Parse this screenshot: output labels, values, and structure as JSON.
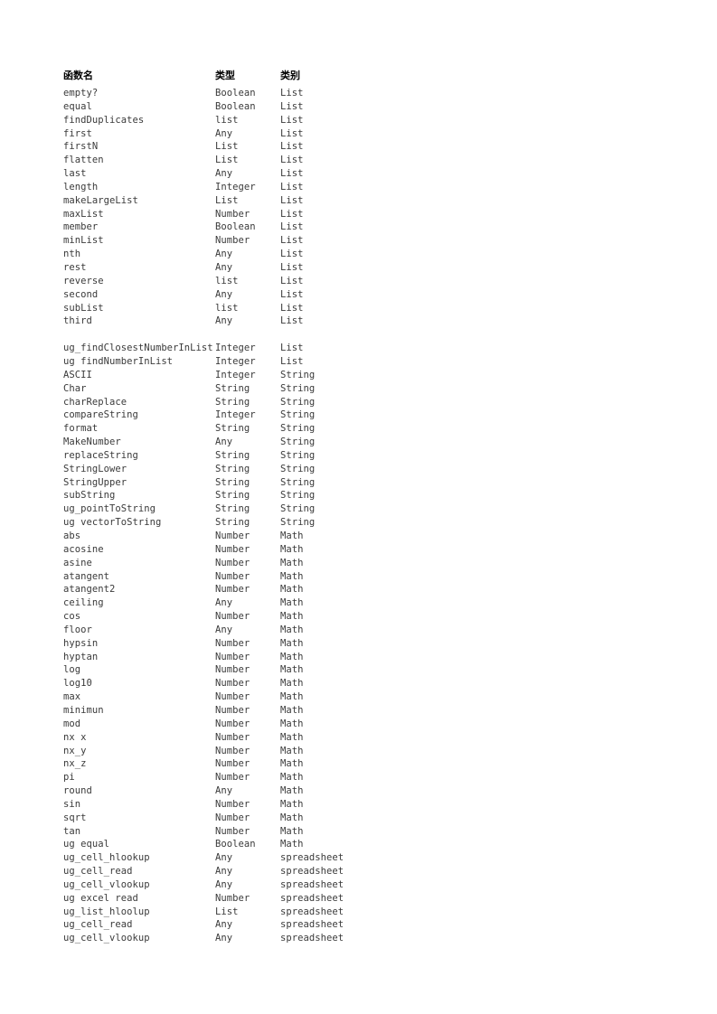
{
  "document": {
    "background_color": "#ffffff",
    "text_color": "#3a3a3a",
    "header_color": "#000000",
    "highlight_color": "#e0727c"
  },
  "table": {
    "columns": [
      {
        "key": "name",
        "label": "函数名"
      },
      {
        "key": "type",
        "label": "类型"
      },
      {
        "key": "category",
        "label": "类别"
      }
    ],
    "rows": [
      {
        "name": "empty?",
        "type": "Boolean",
        "category": "List",
        "highlight": false
      },
      {
        "name": "equal",
        "type": "Boolean",
        "category": "List",
        "highlight": false
      },
      {
        "name": "findDuplicates",
        "type": "list",
        "category": "List",
        "highlight": false
      },
      {
        "name": "first",
        "type": "Any",
        "category": "List",
        "highlight": false
      },
      {
        "name": "firstN",
        "type": "List",
        "category": "List",
        "highlight": false
      },
      {
        "name": "flatten",
        "type": "List",
        "category": "List",
        "highlight": false
      },
      {
        "name": "last",
        "type": "Any",
        "category": "List",
        "highlight": false
      },
      {
        "name": "length",
        "type": "Integer",
        "category": "List",
        "highlight": false
      },
      {
        "name": "makeLargeList",
        "type": "List",
        "category": "List",
        "highlight": false
      },
      {
        "name": "maxList",
        "type": "Number",
        "category": "List",
        "highlight": false
      },
      {
        "name": "member",
        "type": "Boolean",
        "category": "List",
        "highlight": false
      },
      {
        "name": "minList",
        "type": "Number",
        "category": "List",
        "highlight": false
      },
      {
        "name": "nth",
        "type": "Any",
        "category": "List",
        "highlight": true
      },
      {
        "name": "rest",
        "type": "Any",
        "category": "List",
        "highlight": false
      },
      {
        "name": "reverse",
        "type": "list",
        "category": "List",
        "highlight": false
      },
      {
        "name": "second",
        "type": "Any",
        "category": "List",
        "highlight": false
      },
      {
        "name": "subList",
        "type": "list",
        "category": "List",
        "highlight": false
      },
      {
        "name": "third",
        "type": "Any",
        "category": "List",
        "highlight": false
      },
      {
        "name": "",
        "type": "",
        "category": "",
        "highlight": false,
        "spacer": true
      },
      {
        "name": "ug_findClosestNumberInList",
        "type": "Integer",
        "category": "List",
        "highlight": false
      },
      {
        "name": "ug findNumberInList",
        "type": "Integer",
        "category": "List",
        "highlight": true
      },
      {
        "name": "ASCII",
        "type": "Integer",
        "category": "String",
        "highlight": false
      },
      {
        "name": "Char",
        "type": "String",
        "category": "String",
        "highlight": false
      },
      {
        "name": "charReplace",
        "type": "String",
        "category": "String",
        "highlight": false
      },
      {
        "name": "compareString",
        "type": "Integer",
        "category": "String",
        "highlight": false
      },
      {
        "name": "format",
        "type": "String",
        "category": "String",
        "highlight": false
      },
      {
        "name": "MakeNumber",
        "type": "Any",
        "category": "String",
        "highlight": false
      },
      {
        "name": "replaceString",
        "type": "String",
        "category": "String",
        "highlight": false
      },
      {
        "name": "StringLower",
        "type": "String",
        "category": "String",
        "highlight": false
      },
      {
        "name": "StringUpper",
        "type": "String",
        "category": "String",
        "highlight": false
      },
      {
        "name": "subString",
        "type": "String",
        "category": "String",
        "highlight": false
      },
      {
        "name": "ug_pointToString",
        "type": "String",
        "category": "String",
        "highlight": false
      },
      {
        "name": "ug vectorToString",
        "type": "String",
        "category": "String",
        "highlight": false
      },
      {
        "name": "abs",
        "type": "Number",
        "category": "Math",
        "highlight": false
      },
      {
        "name": "acosine",
        "type": "Number",
        "category": "Math",
        "highlight": false
      },
      {
        "name": "asine",
        "type": "Number",
        "category": "Math",
        "highlight": false
      },
      {
        "name": "atangent",
        "type": "Number",
        "category": "Math",
        "highlight": false
      },
      {
        "name": "atangent2",
        "type": "Number",
        "category": "Math",
        "highlight": false
      },
      {
        "name": "ceiling",
        "type": "Any",
        "category": "Math",
        "highlight": false
      },
      {
        "name": "cos",
        "type": "Number",
        "category": "Math",
        "highlight": false
      },
      {
        "name": "floor",
        "type": "Any",
        "category": "Math",
        "highlight": false
      },
      {
        "name": "hypsin",
        "type": "Number",
        "category": "Math",
        "highlight": false
      },
      {
        "name": "hyptan",
        "type": "Number",
        "category": "Math",
        "highlight": false
      },
      {
        "name": "log",
        "type": "Number",
        "category": "Math",
        "highlight": false
      },
      {
        "name": "log10",
        "type": "Number",
        "category": "Math",
        "highlight": false
      },
      {
        "name": "max",
        "type": "Number",
        "category": "Math",
        "highlight": false
      },
      {
        "name": "minimun",
        "type": "Number",
        "category": "Math",
        "highlight": false
      },
      {
        "name": "mod",
        "type": "Number",
        "category": "Math",
        "highlight": false
      },
      {
        "name": "nx x",
        "type": "Number",
        "category": "Math",
        "highlight": false
      },
      {
        "name": "nx_y",
        "type": "Number",
        "category": "Math",
        "highlight": false
      },
      {
        "name": "nx_z",
        "type": "Number",
        "category": "Math",
        "highlight": false
      },
      {
        "name": "pi",
        "type": "Number",
        "category": "Math",
        "highlight": false
      },
      {
        "name": "round",
        "type": "Any",
        "category": "Math",
        "highlight": false
      },
      {
        "name": "sin",
        "type": "Number",
        "category": "Math",
        "highlight": false
      },
      {
        "name": "sqrt",
        "type": "Number",
        "category": "Math",
        "highlight": false
      },
      {
        "name": "tan",
        "type": "Number",
        "category": "Math",
        "highlight": false
      },
      {
        "name": "ug equal",
        "type": "Boolean",
        "category": "Math",
        "highlight": false
      },
      {
        "name": "ug_cell_hlookup",
        "type": "Any",
        "category": "spreadsheet",
        "highlight": false
      },
      {
        "name": "ug_cell_read",
        "type": "Any",
        "category": "spreadsheet",
        "highlight": false
      },
      {
        "name": "ug_cell_vlookup",
        "type": "Any",
        "category": "spreadsheet",
        "highlight": false
      },
      {
        "name": "ug excel read",
        "type": "Number",
        "category": "spreadsheet",
        "highlight": false
      },
      {
        "name": "ug_list_hloolup",
        "type": "List",
        "category": "spreadsheet",
        "highlight": false
      },
      {
        "name": "ug_cell_read",
        "type": "Any",
        "category": "spreadsheet",
        "highlight": false
      },
      {
        "name": "ug_cell_vlookup",
        "type": "Any",
        "category": "spreadsheet",
        "highlight": false
      }
    ]
  }
}
